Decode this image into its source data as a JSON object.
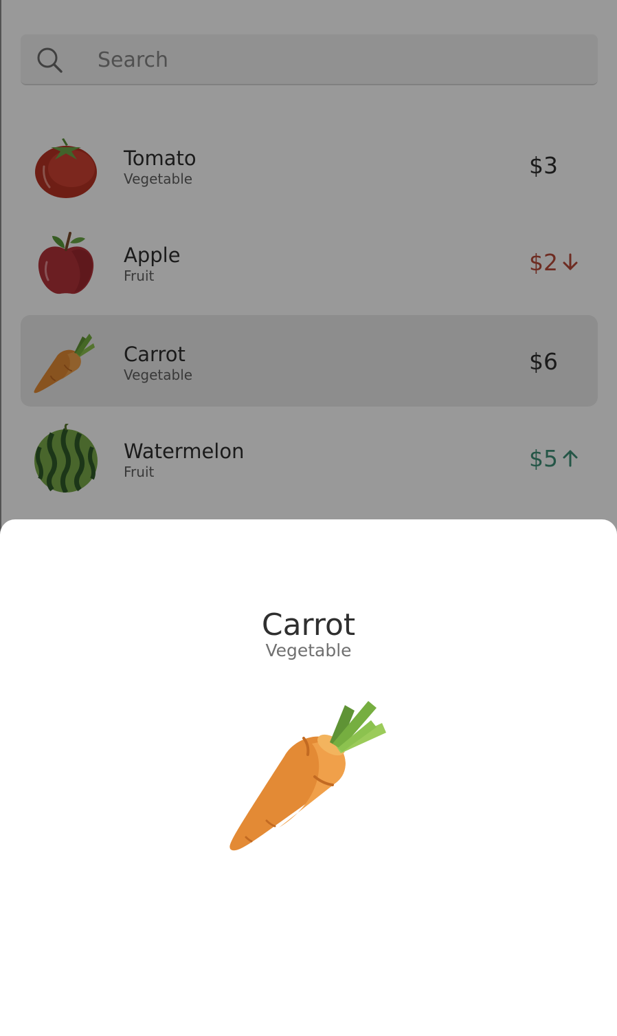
{
  "search": {
    "placeholder": "Search",
    "value": ""
  },
  "list": {
    "items": [
      {
        "name": "Tomato",
        "category": "Vegetable",
        "price": "$3",
        "trend": "none",
        "image": "tomato-image",
        "selected": false
      },
      {
        "name": "Apple",
        "category": "Fruit",
        "price": "$2",
        "trend": "down",
        "image": "apple-image",
        "selected": false
      },
      {
        "name": "Carrot",
        "category": "Vegetable",
        "price": "$6",
        "trend": "none",
        "image": "carrot-image",
        "selected": true
      },
      {
        "name": "Watermelon",
        "category": "Fruit",
        "price": "$5",
        "trend": "up",
        "image": "watermelon-image",
        "selected": false
      }
    ]
  },
  "detail_sheet": {
    "title": "Carrot",
    "subtitle": "Vegetable",
    "image": "carrot-image"
  },
  "colors": {
    "price_down": "#b84a39",
    "price_up": "#3f8f77",
    "text_primary": "#2e2e2e",
    "text_secondary": "#5f5f5f",
    "scrim": "rgba(0,0,0,0.4)"
  }
}
